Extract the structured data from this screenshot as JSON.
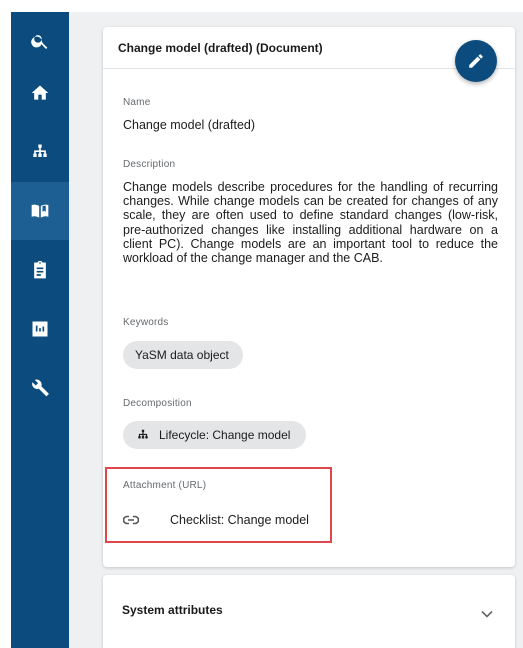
{
  "sidebar": {
    "items": [
      {
        "icon": "search-icon",
        "active": false
      },
      {
        "icon": "home-icon",
        "active": false
      },
      {
        "icon": "sitemap-icon",
        "active": false
      },
      {
        "icon": "book-icon",
        "active": true
      },
      {
        "icon": "clipboard-icon",
        "active": false
      },
      {
        "icon": "chart-icon",
        "active": false
      },
      {
        "icon": "wrench-icon",
        "active": false
      }
    ]
  },
  "card": {
    "title": "Change model (drafted)  (Document)",
    "edit_icon": "pencil-icon"
  },
  "fields": {
    "name_label": "Name",
    "name_value": "Change model (drafted)",
    "description_label": "Description",
    "description_value": "Change models describe procedures for the handling of recurring changes. While change models can be created for changes of any scale, they are often used to define standard changes (low-risk, pre-authorized changes like installing additional hardware on a client PC). Change models are an important tool to reduce the workload of the change manager and the CAB.",
    "keywords_label": "Keywords",
    "keyword_chip": "YaSM data object",
    "decomposition_label": "Decomposition",
    "decomposition_chip": "Lifecycle: Change model",
    "attachment_label": "Attachment (URL)",
    "attachment_link": "Checklist: Change model"
  },
  "system_attributes": {
    "title": "System attributes"
  },
  "colors": {
    "sidebar": "#0c4b7d",
    "highlight_border": "#e0474c",
    "content_bg": "#eef0f2"
  }
}
